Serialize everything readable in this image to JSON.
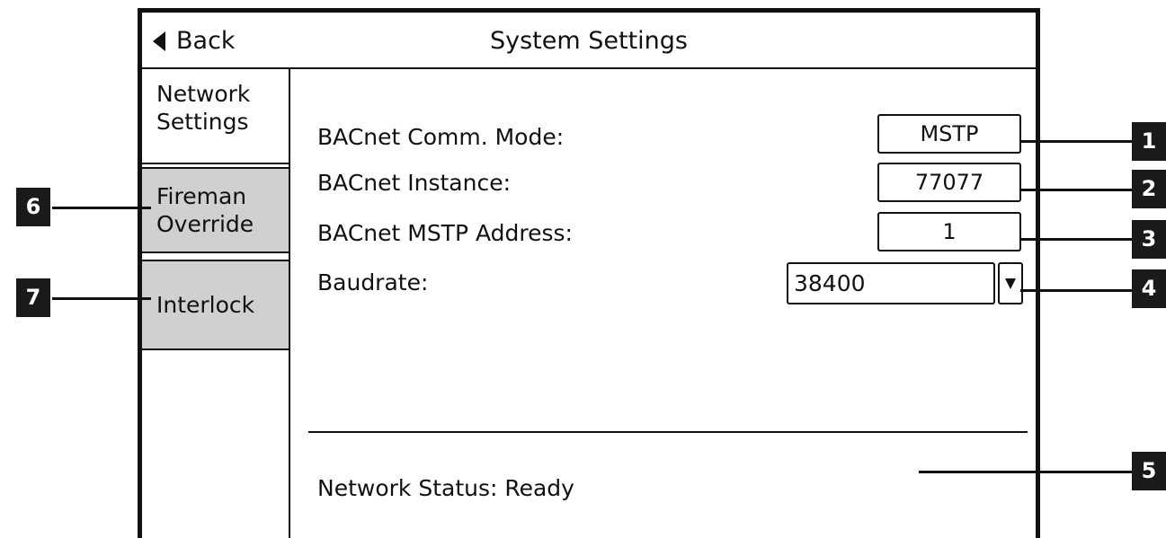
{
  "header": {
    "back_label": "Back",
    "title": "System Settings"
  },
  "sidebar": {
    "items": [
      {
        "label": "Network Settings"
      },
      {
        "label": "Fireman Override"
      },
      {
        "label": "Interlock"
      }
    ]
  },
  "network": {
    "comm_mode_label": "BACnet Comm. Mode:",
    "comm_mode_value": "MSTP",
    "instance_label": "BACnet Instance:",
    "instance_value": "77077",
    "mstp_address_label": "BACnet MSTP Address:",
    "mstp_address_value": "1",
    "baudrate_label": "Baudrate:",
    "baudrate_value": "38400",
    "status_text": "Network Status: Ready"
  },
  "callouts": {
    "c1": "1",
    "c2": "2",
    "c3": "3",
    "c4": "4",
    "c5": "5",
    "c6": "6",
    "c7": "7"
  },
  "colors": {
    "tab_background": "#d0d0d0",
    "callout_background": "#1a1a1a",
    "border": "#111111"
  },
  "icons": {
    "back": "left-triangle-icon",
    "dropdown": "down-triangle-icon"
  }
}
